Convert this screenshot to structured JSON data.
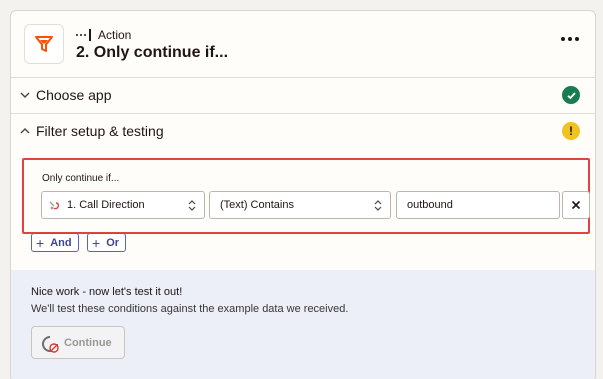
{
  "step": {
    "type_label": "Action",
    "title": "2. Only continue if...",
    "icon": "filter-icon",
    "menu_icon": "more-horizontal-icon"
  },
  "sections": {
    "choose_app": {
      "label": "Choose app",
      "status": "complete",
      "status_color": "#187c4e"
    },
    "filter_setup": {
      "label": "Filter setup & testing",
      "status": "warning",
      "status_symbol": "!",
      "status_color": "#f0c21d"
    }
  },
  "filter": {
    "heading": "Only continue if...",
    "field": {
      "value": "1. Call Direction",
      "icon": "app-source-icon"
    },
    "condition": {
      "value": "(Text) Contains"
    },
    "value_input": {
      "value": "outbound"
    },
    "remove_symbol": "×",
    "and_label": "And",
    "or_label": "Or",
    "highlight_color": "#e04440"
  },
  "test": {
    "title": "Nice work - now let's test it out!",
    "subtitle": "We'll test these conditions against the example data we received.",
    "continue_label": "Continue",
    "continue_state": "disabled"
  },
  "colors": {
    "accent": "#5763bd",
    "brand_orange": "#ff4f00"
  }
}
